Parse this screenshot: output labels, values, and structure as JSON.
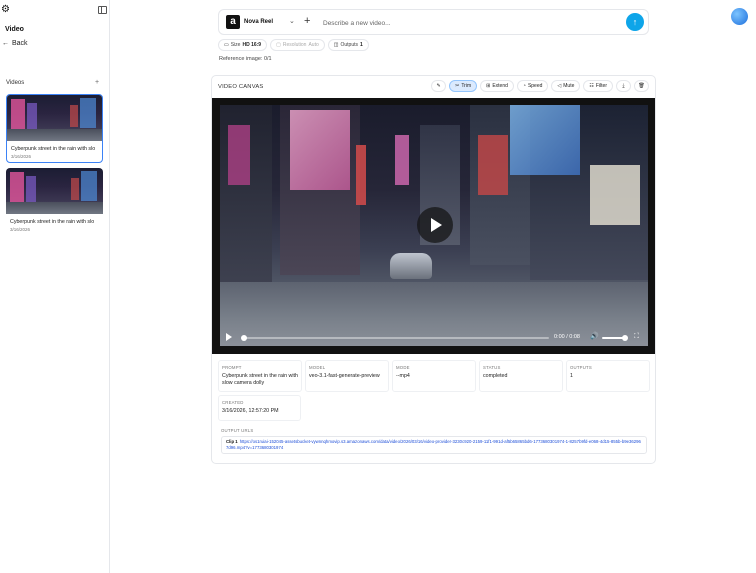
{
  "sidebar": {
    "title": "Video",
    "back_label": "Back",
    "videos_heading": "Videos",
    "add_label": "+",
    "videos": [
      {
        "caption": "Cyberpunk street in the rain with slo",
        "date": "3/16/2026",
        "active": true
      },
      {
        "caption": "Cyberpunk street in the rain with slo",
        "date": "3/16/2026",
        "active": false
      }
    ]
  },
  "topbar": {
    "model_name": "Nova Reel",
    "prompt_placeholder": "Describe a new video...",
    "prompt_value": ""
  },
  "chips": {
    "size_key": "Size",
    "size_value": "HD 16:9",
    "resolution_key": "Resolution",
    "resolution_value": "Auto",
    "outputs_key": "Outputs",
    "outputs_value": "1"
  },
  "reference_text": "Reference image: 0/1",
  "canvas": {
    "title": "VIDEO CANVAS",
    "toolbar": {
      "trim": "Trim",
      "extend": "Extend",
      "speed": "Speed",
      "mute": "Mute",
      "filter": "Filter"
    },
    "player": {
      "time": "0:00 / 0:08",
      "progress": 0.0,
      "volume": 1.0
    },
    "meta": {
      "prompt_label": "PROMPT",
      "prompt_value": "Cyberpunk street in the rain with slow camera dolly",
      "model_label": "MODEL",
      "model_value": "veo-3.1-fast-generate-preview",
      "mode_label": "MODE",
      "mode_value": "--mp4",
      "status_label": "STATUS",
      "status_value": "completed",
      "outputs_label": "OUTPUTS",
      "outputs_value": "1",
      "created_label": "CREATED",
      "created_value": "3/16/2026, 12:57:20 PM"
    },
    "output_urls_label": "OUTPUT URLS",
    "clip_label": "Clip 1",
    "clip_url": "https://os1ruiai-152045-assetsbucket-vywnnqhmovip.s3.amazonaws.com/data/video/2026/03/16/video-provider-3230c920-2159-11f1-991d-af5b65865bd6-1773680301974-1-8257b9fd-e068-4d15-855b-b9e362967d96.mp4?v=1773680301974"
  },
  "colors": {
    "accent": "#0ea5e9",
    "active_chip": "#dbeafe",
    "link": "#1d4ed8"
  }
}
